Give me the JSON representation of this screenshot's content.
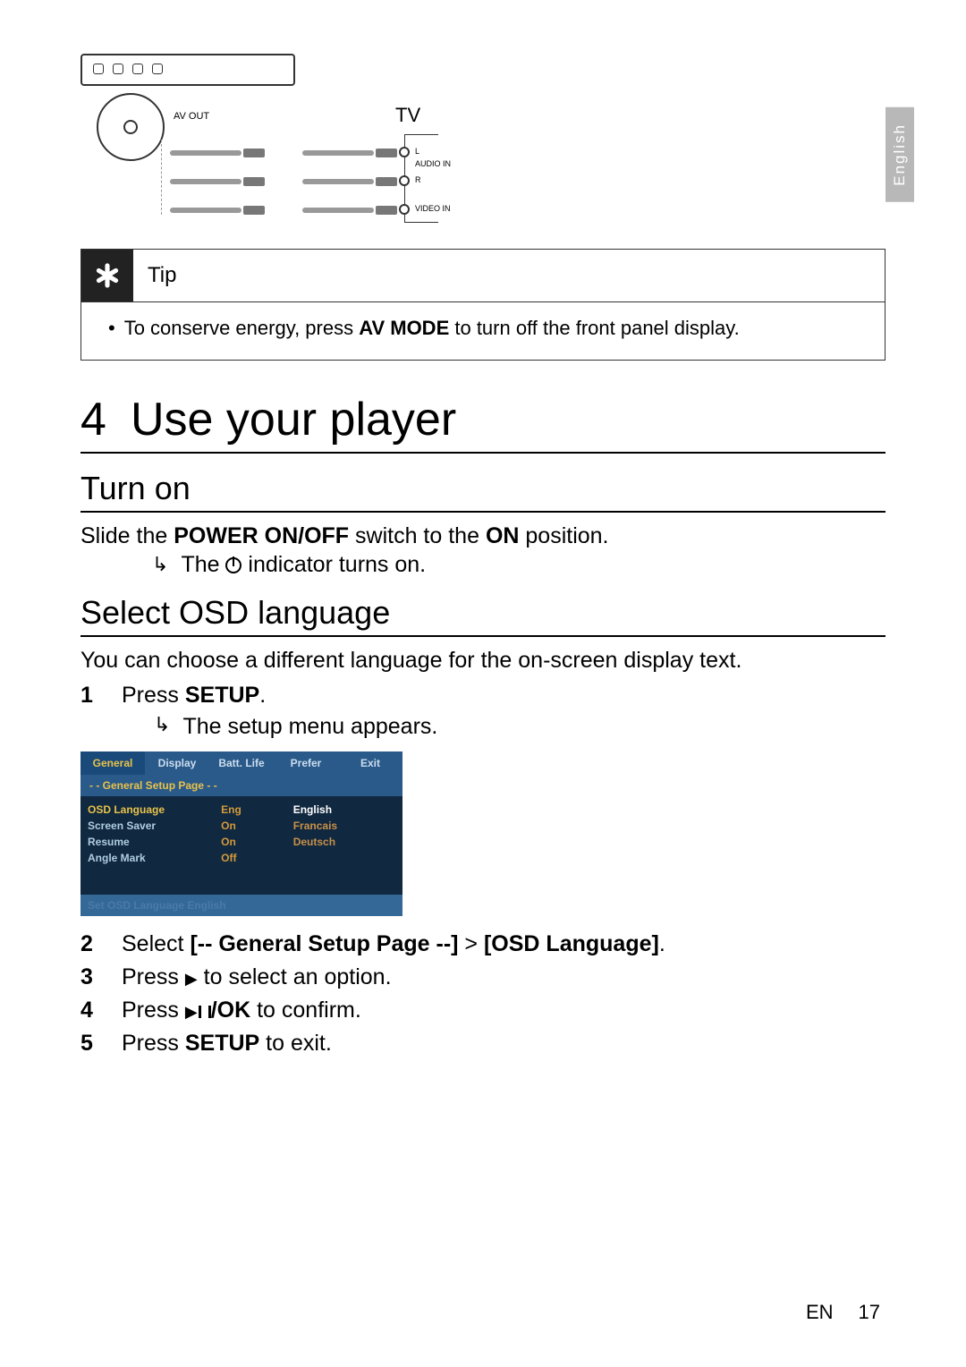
{
  "lang_tab": "English",
  "diagram": {
    "av_out": "AV OUT",
    "tv": "TV",
    "l": "L",
    "r": "R",
    "audio_in": "AUDIO IN",
    "video_in": "VIDEO IN"
  },
  "tip": {
    "title": "Tip",
    "body_prefix": "To conserve energy, press ",
    "body_bold": "AV MODE",
    "body_suffix": " to turn off the front panel display."
  },
  "section": {
    "number": "4",
    "title": "Use your player"
  },
  "turn_on": {
    "heading": "Turn on",
    "line_prefix": "Slide the ",
    "line_bold1": "POWER ON/OFF",
    "line_mid": " switch to the ",
    "line_bold2": "ON",
    "line_suffix": " position.",
    "result_prefix": "The ",
    "result_suffix": " indicator turns on."
  },
  "osd_lang": {
    "heading": "Select OSD language",
    "intro": "You can choose a different language for the on-screen display text.",
    "step1_prefix": "Press ",
    "step1_bold": "SETUP",
    "step1_suffix": ".",
    "step1_result": "The setup menu appears.",
    "step2_prefix": "Select ",
    "step2_bold1": "[-- General Setup Page --]",
    "step2_gt": " > ",
    "step2_bold2": "[OSD Language]",
    "step2_suffix": ".",
    "step3_prefix": "Press ",
    "step3_suffix": " to select an option.",
    "step4_prefix": "Press ",
    "step4_bold": "/OK",
    "step4_suffix": " to confirm.",
    "step5_prefix": "Press ",
    "step5_bold": "SETUP",
    "step5_suffix": " to exit."
  },
  "osd_menu": {
    "tabs": [
      "General",
      "Display",
      "Batt. Life",
      "Prefer",
      "Exit"
    ],
    "page_bar": "- -    General Setup Page    - -",
    "rows": [
      {
        "label": "OSD  Language",
        "value": "Eng"
      },
      {
        "label": "Screen Saver",
        "value": "On"
      },
      {
        "label": "Resume",
        "value": "On"
      },
      {
        "label": "Angle Mark",
        "value": "Off"
      }
    ],
    "lang_options": [
      "English",
      "Francais",
      "Deutsch"
    ],
    "footer": "Set OSD Language English"
  },
  "footer": {
    "lang": "EN",
    "page": "17"
  }
}
